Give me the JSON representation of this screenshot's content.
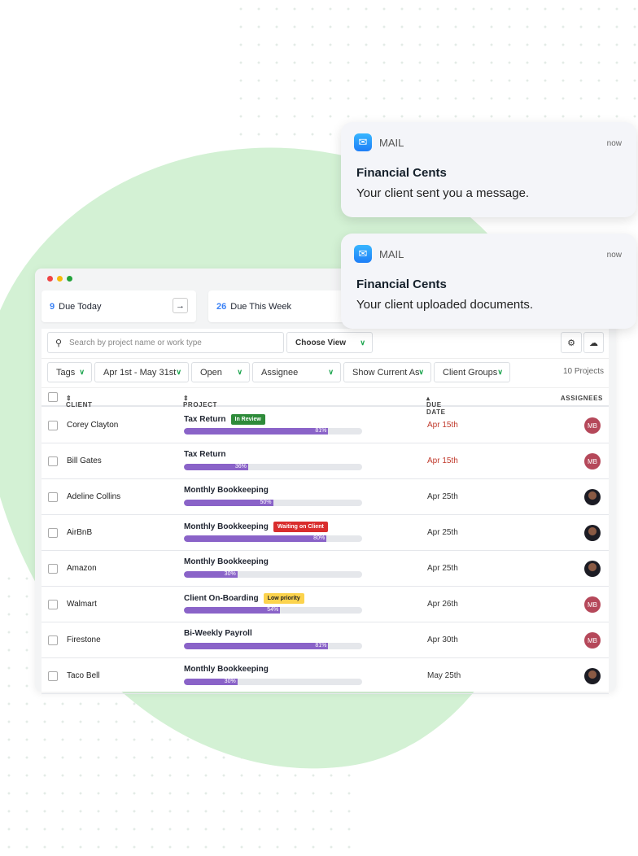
{
  "window": {
    "summary": [
      {
        "count": "9",
        "label": "Due Today"
      },
      {
        "count": "26",
        "label": "Due This Week"
      }
    ]
  },
  "toolbar": {
    "search_placeholder": "Search by project name or work type",
    "choose_view": "Choose View",
    "project_count": "10 Projects"
  },
  "filters": [
    "Tags",
    "Apr 1st - May 31st",
    "Open",
    "Assignee",
    "Show Current As",
    "Client Groups"
  ],
  "table": {
    "headers": {
      "client": "CLIENT",
      "project": "PROJECT",
      "due": "DUE DATE",
      "assignees": "ASSIGNEES"
    },
    "rows": [
      {
        "client": "Corey Clayton",
        "project": "Tax Return",
        "tag": "In Review",
        "tag_color": "#2e8b3a",
        "progress": 81,
        "progress_label": "81%",
        "due": "Apr 15th",
        "overdue": true,
        "assignee": "MB"
      },
      {
        "client": "Bill Gates",
        "project": "Tax Return",
        "tag": "",
        "progress": 36,
        "progress_label": "36%",
        "due": "Apr 15th",
        "overdue": true,
        "assignee": "MB"
      },
      {
        "client": "Adeline Collins",
        "project": "Monthly Bookkeeping",
        "tag": "",
        "progress": 50,
        "progress_label": "50%",
        "due": "Apr 25th",
        "overdue": false,
        "assignee": "photo"
      },
      {
        "client": "AirBnB",
        "project": "Monthly Bookkeeping",
        "tag": "Waiting on Client",
        "tag_color": "#d92d2d",
        "progress": 80,
        "progress_label": "80%",
        "due": "Apr 25th",
        "overdue": false,
        "assignee": "photo"
      },
      {
        "client": "Amazon",
        "project": "Monthly Bookkeeping",
        "tag": "",
        "progress": 30,
        "progress_label": "30%",
        "due": "Apr 25th",
        "overdue": false,
        "assignee": "photo"
      },
      {
        "client": "Walmart",
        "project": "Client On-Boarding",
        "tag": "Low priority",
        "tag_color": "#fcd34d",
        "progress": 54,
        "progress_label": "54%",
        "due": "Apr 26th",
        "overdue": false,
        "assignee": "MB"
      },
      {
        "client": "Firestone",
        "project": "Bi-Weekly Payroll",
        "tag": "",
        "progress": 81,
        "progress_label": "81%",
        "due": "Apr 30th",
        "overdue": false,
        "assignee": "MB"
      },
      {
        "client": "Taco Bell",
        "project": "Monthly Bookkeeping",
        "tag": "",
        "progress": 30,
        "progress_label": "30%",
        "due": "May 25th",
        "overdue": false,
        "assignee": "photo"
      }
    ]
  },
  "notifications": [
    {
      "app": "MAIL",
      "time": "now",
      "title": "Financial Cents",
      "body": "Your client sent you a message."
    },
    {
      "app": "MAIL",
      "time": "now",
      "title": "Financial Cents",
      "body": "Your client uploaded documents."
    }
  ],
  "colors": {
    "accent": "#8a63c8",
    "overdue": "#c0392b",
    "blob": "#d3f1d4",
    "avatar": "#b5485a"
  }
}
